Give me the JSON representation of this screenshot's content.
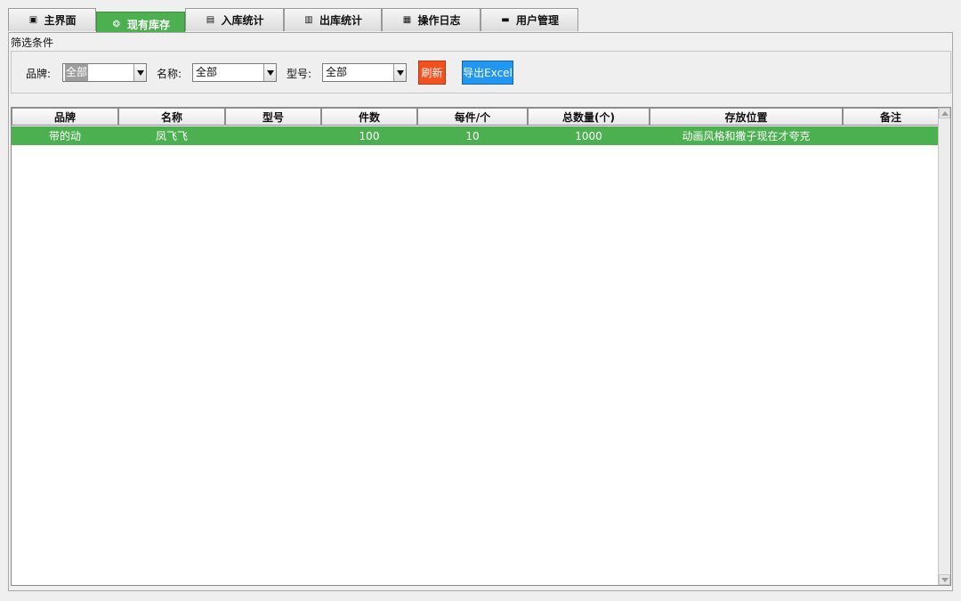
{
  "tabs": [
    {
      "label": "主界面",
      "icon": "document-icon",
      "glyph": "▣"
    },
    {
      "label": "现有库存",
      "icon": "cube-icon",
      "glyph": "❂"
    },
    {
      "label": "入库统计",
      "icon": "chart-icon",
      "glyph": "▤"
    },
    {
      "label": "出库统计",
      "icon": "chart-icon",
      "glyph": "▥"
    },
    {
      "label": "操作日志",
      "icon": "log-icon",
      "glyph": "▦"
    },
    {
      "label": "用户管理",
      "icon": "user-icon",
      "glyph": "▬"
    }
  ],
  "active_tab": "现有库存",
  "filter": {
    "legend": "筛选条件",
    "brand_label": "品牌:",
    "brand_value": "全部",
    "name_label": "名称:",
    "name_value": "全部",
    "model_label": "型号:",
    "model_value": "全部",
    "refresh_label": "刷新",
    "export_label": "导出Excel"
  },
  "colors": {
    "accent_green": "#4caf50",
    "refresh_button": "#f4511e",
    "export_button": "#2196f3"
  },
  "table": {
    "columns": [
      "品牌",
      "名称",
      "型号",
      "件数",
      "每件/个",
      "总数量(个)",
      "存放位置",
      "备注"
    ],
    "rows": [
      [
        "带的动",
        "凤飞飞",
        "",
        "100",
        "10",
        "1000",
        "动画风格和撒子现在才夸克",
        ""
      ]
    ]
  }
}
